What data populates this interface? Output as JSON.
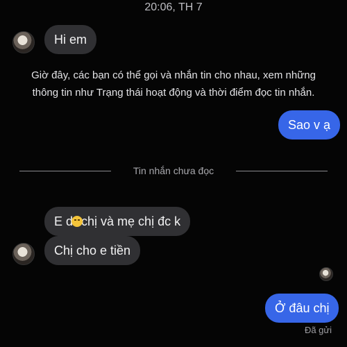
{
  "header": {
    "timestamp": "20:06, TH 7"
  },
  "messages": {
    "hi": "Hi em",
    "sao": "Sao v ạ",
    "e_prefix": "E d",
    "e_suffix": "chị và mẹ chị đc k",
    "tien": "Chị cho e tiền",
    "odau": "Ở đâu chị"
  },
  "notice": {
    "line1": "Giờ đây, các bạn có thể gọi và nhắn tin cho nhau, xem những",
    "line2": "thông tin như Trạng thái hoạt động và thời điểm đọc tin nhắn."
  },
  "divider": {
    "label": "Tin nhắn chưa đọc"
  },
  "status": {
    "sent": "Đã gửi"
  },
  "icons": {
    "emoji": "anxious-face-emoji",
    "avatar": "contact-avatar"
  },
  "colors": {
    "incoming": "#303033",
    "outgoing": "#3766e8",
    "background": "#050505"
  }
}
